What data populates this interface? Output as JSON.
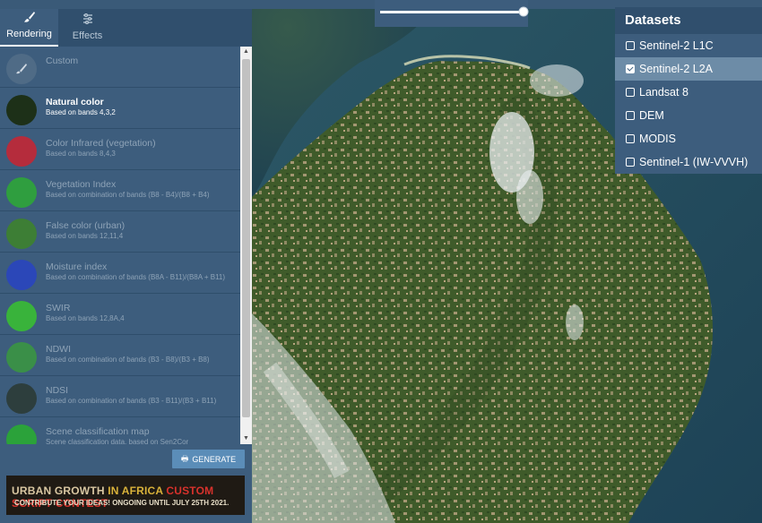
{
  "tabs": [
    {
      "label": "Rendering",
      "icon": "brush-icon",
      "active": true
    },
    {
      "label": "Effects",
      "icon": "sliders-icon",
      "active": false
    }
  ],
  "layers": [
    {
      "name": "Custom",
      "desc": "",
      "color": "#4f6b86"
    },
    {
      "name": "Natural color",
      "desc": "Based on bands 4,3,2",
      "color": "#1d3018"
    },
    {
      "name": "Color Infrared (vegetation)",
      "desc": "Based on bands 8,4,3",
      "color": "#b52c3c"
    },
    {
      "name": "Vegetation Index",
      "desc": "Based on combination of bands (B8 - B4)/(B8 + B4)",
      "color": "#2f9e3f"
    },
    {
      "name": "False color (urban)",
      "desc": "Based on bands 12,11,4",
      "color": "#3d7e35"
    },
    {
      "name": "Moisture index",
      "desc": "Based on combination of bands (B8A - B11)/(B8A + B11)",
      "color": "#2b47b8"
    },
    {
      "name": "SWIR",
      "desc": "Based on bands 12,8A,4",
      "color": "#39b33b"
    },
    {
      "name": "NDWI",
      "desc": "Based on combination of bands (B3 - B8)/(B3 + B8)",
      "color": "#3a8f48"
    },
    {
      "name": "NDSI",
      "desc": "Based on combination of bands (B3 - B11)/(B3 + B11)",
      "color": "#2d3e3d"
    },
    {
      "name": "Scene classification map",
      "desc": "Scene classification data, based on Sen2Cor",
      "color": "#2ba23a"
    }
  ],
  "active_layer": "Natural color",
  "generate_label": "GENERATE",
  "banner": {
    "part1": "URBAN GROWTH ",
    "part2": "IN AFRICA ",
    "part3": "CUSTOM SCRIPT CONTEST",
    "line2": "CONTRIBUTE YOUR IDEAS! ONGOING UNTIL JULY 25TH 2021."
  },
  "datasets": {
    "title": "Datasets",
    "items": [
      {
        "label": "Sentinel-2 L1C",
        "checked": false
      },
      {
        "label": "Sentinel-2 L2A",
        "checked": true
      },
      {
        "label": "Landsat 8",
        "checked": false
      },
      {
        "label": "DEM",
        "checked": false
      },
      {
        "label": "MODIS",
        "checked": false
      },
      {
        "label": "Sentinel-1 (IW-VVVH)",
        "checked": false
      }
    ]
  },
  "opacity_slider": {
    "value": 1.0
  },
  "colors": {
    "panel": "#3d5d7d",
    "header": "#304f6d",
    "accent": "#5b8db8",
    "selected": "#6d8ca7"
  }
}
